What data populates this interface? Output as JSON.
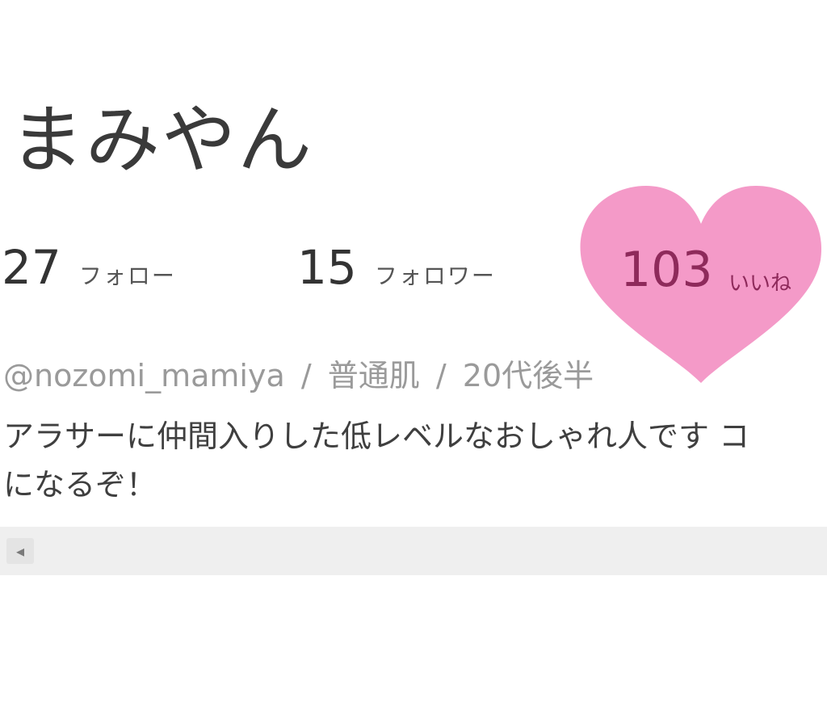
{
  "profile": {
    "name": "まみやん"
  },
  "stats": {
    "follow": {
      "count": "27",
      "label": "フォロー"
    },
    "follower": {
      "count": "15",
      "label": "フォロワー"
    },
    "likes": {
      "count": "103",
      "label": "いいね"
    }
  },
  "meta": {
    "handle": "@nozomi_mamiya",
    "separator": "/",
    "skin_type": "普通肌",
    "age_group": "20代後半"
  },
  "bio": {
    "line1": "アラサーに仲間入りした低レベルなおしゃれ人です コ",
    "line2": "になるぞ！"
  },
  "scroll": {
    "left_icon": "chevron-left-icon",
    "left_glyph": "◂"
  },
  "colors": {
    "heart": "#f49ac8",
    "heart_text": "#8e2a5b",
    "muted_text": "#9a9a9a",
    "scrollbar": "#efefef"
  }
}
